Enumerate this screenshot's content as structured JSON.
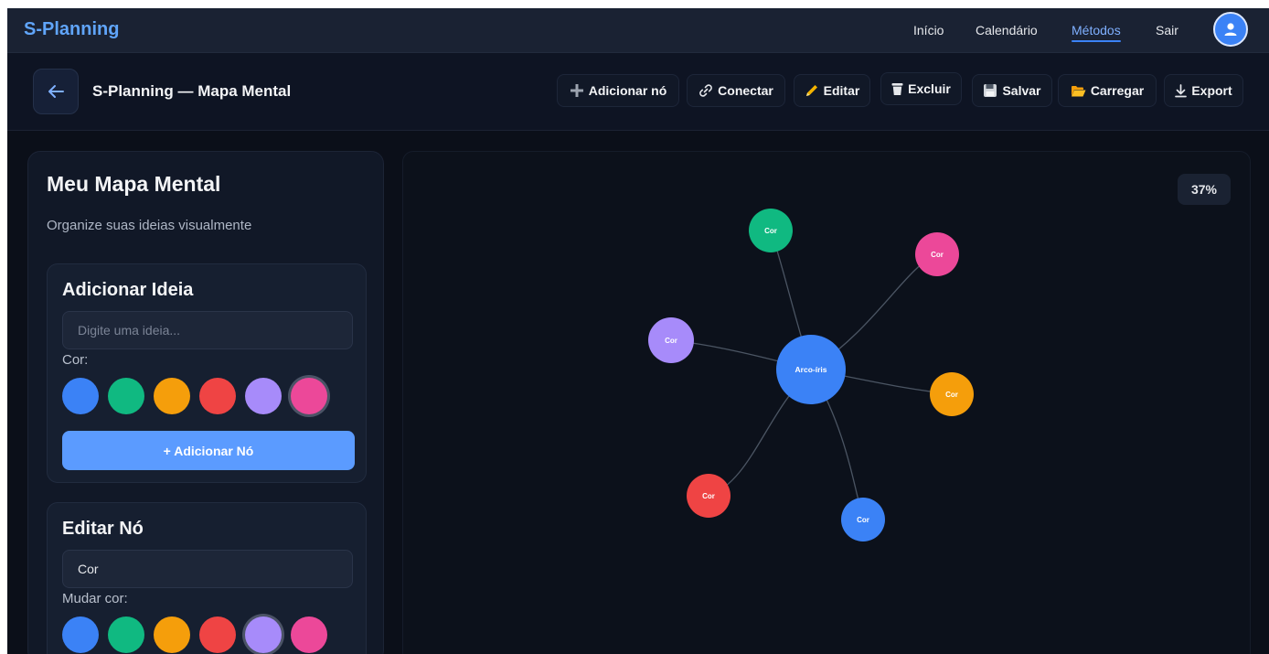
{
  "nav": {
    "brand": "S-Planning",
    "links": [
      "Início",
      "Calendário",
      "Métodos",
      "Sair"
    ],
    "active_link": "Métodos"
  },
  "toolbar": {
    "title": "S-Planning — Mapa Mental",
    "buttons": [
      {
        "label": "Adicionar nó",
        "icon": "plus-icon"
      },
      {
        "label": "Conectar",
        "icon": "link-icon"
      },
      {
        "label": "Editar",
        "icon": "pencil-icon"
      },
      {
        "label": "Excluir",
        "icon": "trash-icon"
      },
      {
        "label": "Salvar",
        "icon": "floppy-icon"
      },
      {
        "label": "Carregar",
        "icon": "folder-icon"
      },
      {
        "label": "Export",
        "icon": "download-icon"
      }
    ]
  },
  "sidebar": {
    "title": "Meu Mapa Mental",
    "subtitle": "Organize suas ideias visualmente",
    "add_card": {
      "title": "Adicionar Ideia",
      "input_placeholder": "Digite uma ideia...",
      "input_value": "",
      "color_label": "Cor:",
      "selected_color": "#ec4899",
      "button_label": "+ Adicionar Nó"
    },
    "edit_card": {
      "title": "Editar Nó",
      "input_value": "Cor",
      "color_label": "Mudar cor:",
      "selected_color": "#a78bfa"
    }
  },
  "palette": [
    "#3b82f6",
    "#10b981",
    "#f59e0b",
    "#ef4444",
    "#a78bfa",
    "#ec4899"
  ],
  "canvas": {
    "zoom_label": "37%",
    "edge_color": "#4b5563",
    "center_node": {
      "label": "Arco-íris",
      "color": "#3b82f6"
    },
    "nodes": [
      {
        "label": "Cor",
        "color": "#10b981"
      },
      {
        "label": "Cor",
        "color": "#ec4899"
      },
      {
        "label": "Cor",
        "color": "#a78bfa"
      },
      {
        "label": "Cor",
        "color": "#f59e0b"
      },
      {
        "label": "Cor",
        "color": "#ef4444"
      },
      {
        "label": "Cor",
        "color": "#3b82f6"
      }
    ]
  },
  "colors": {
    "accent": "#3b82f6",
    "brand": "#60a5fa",
    "background": "#0b0f19"
  }
}
